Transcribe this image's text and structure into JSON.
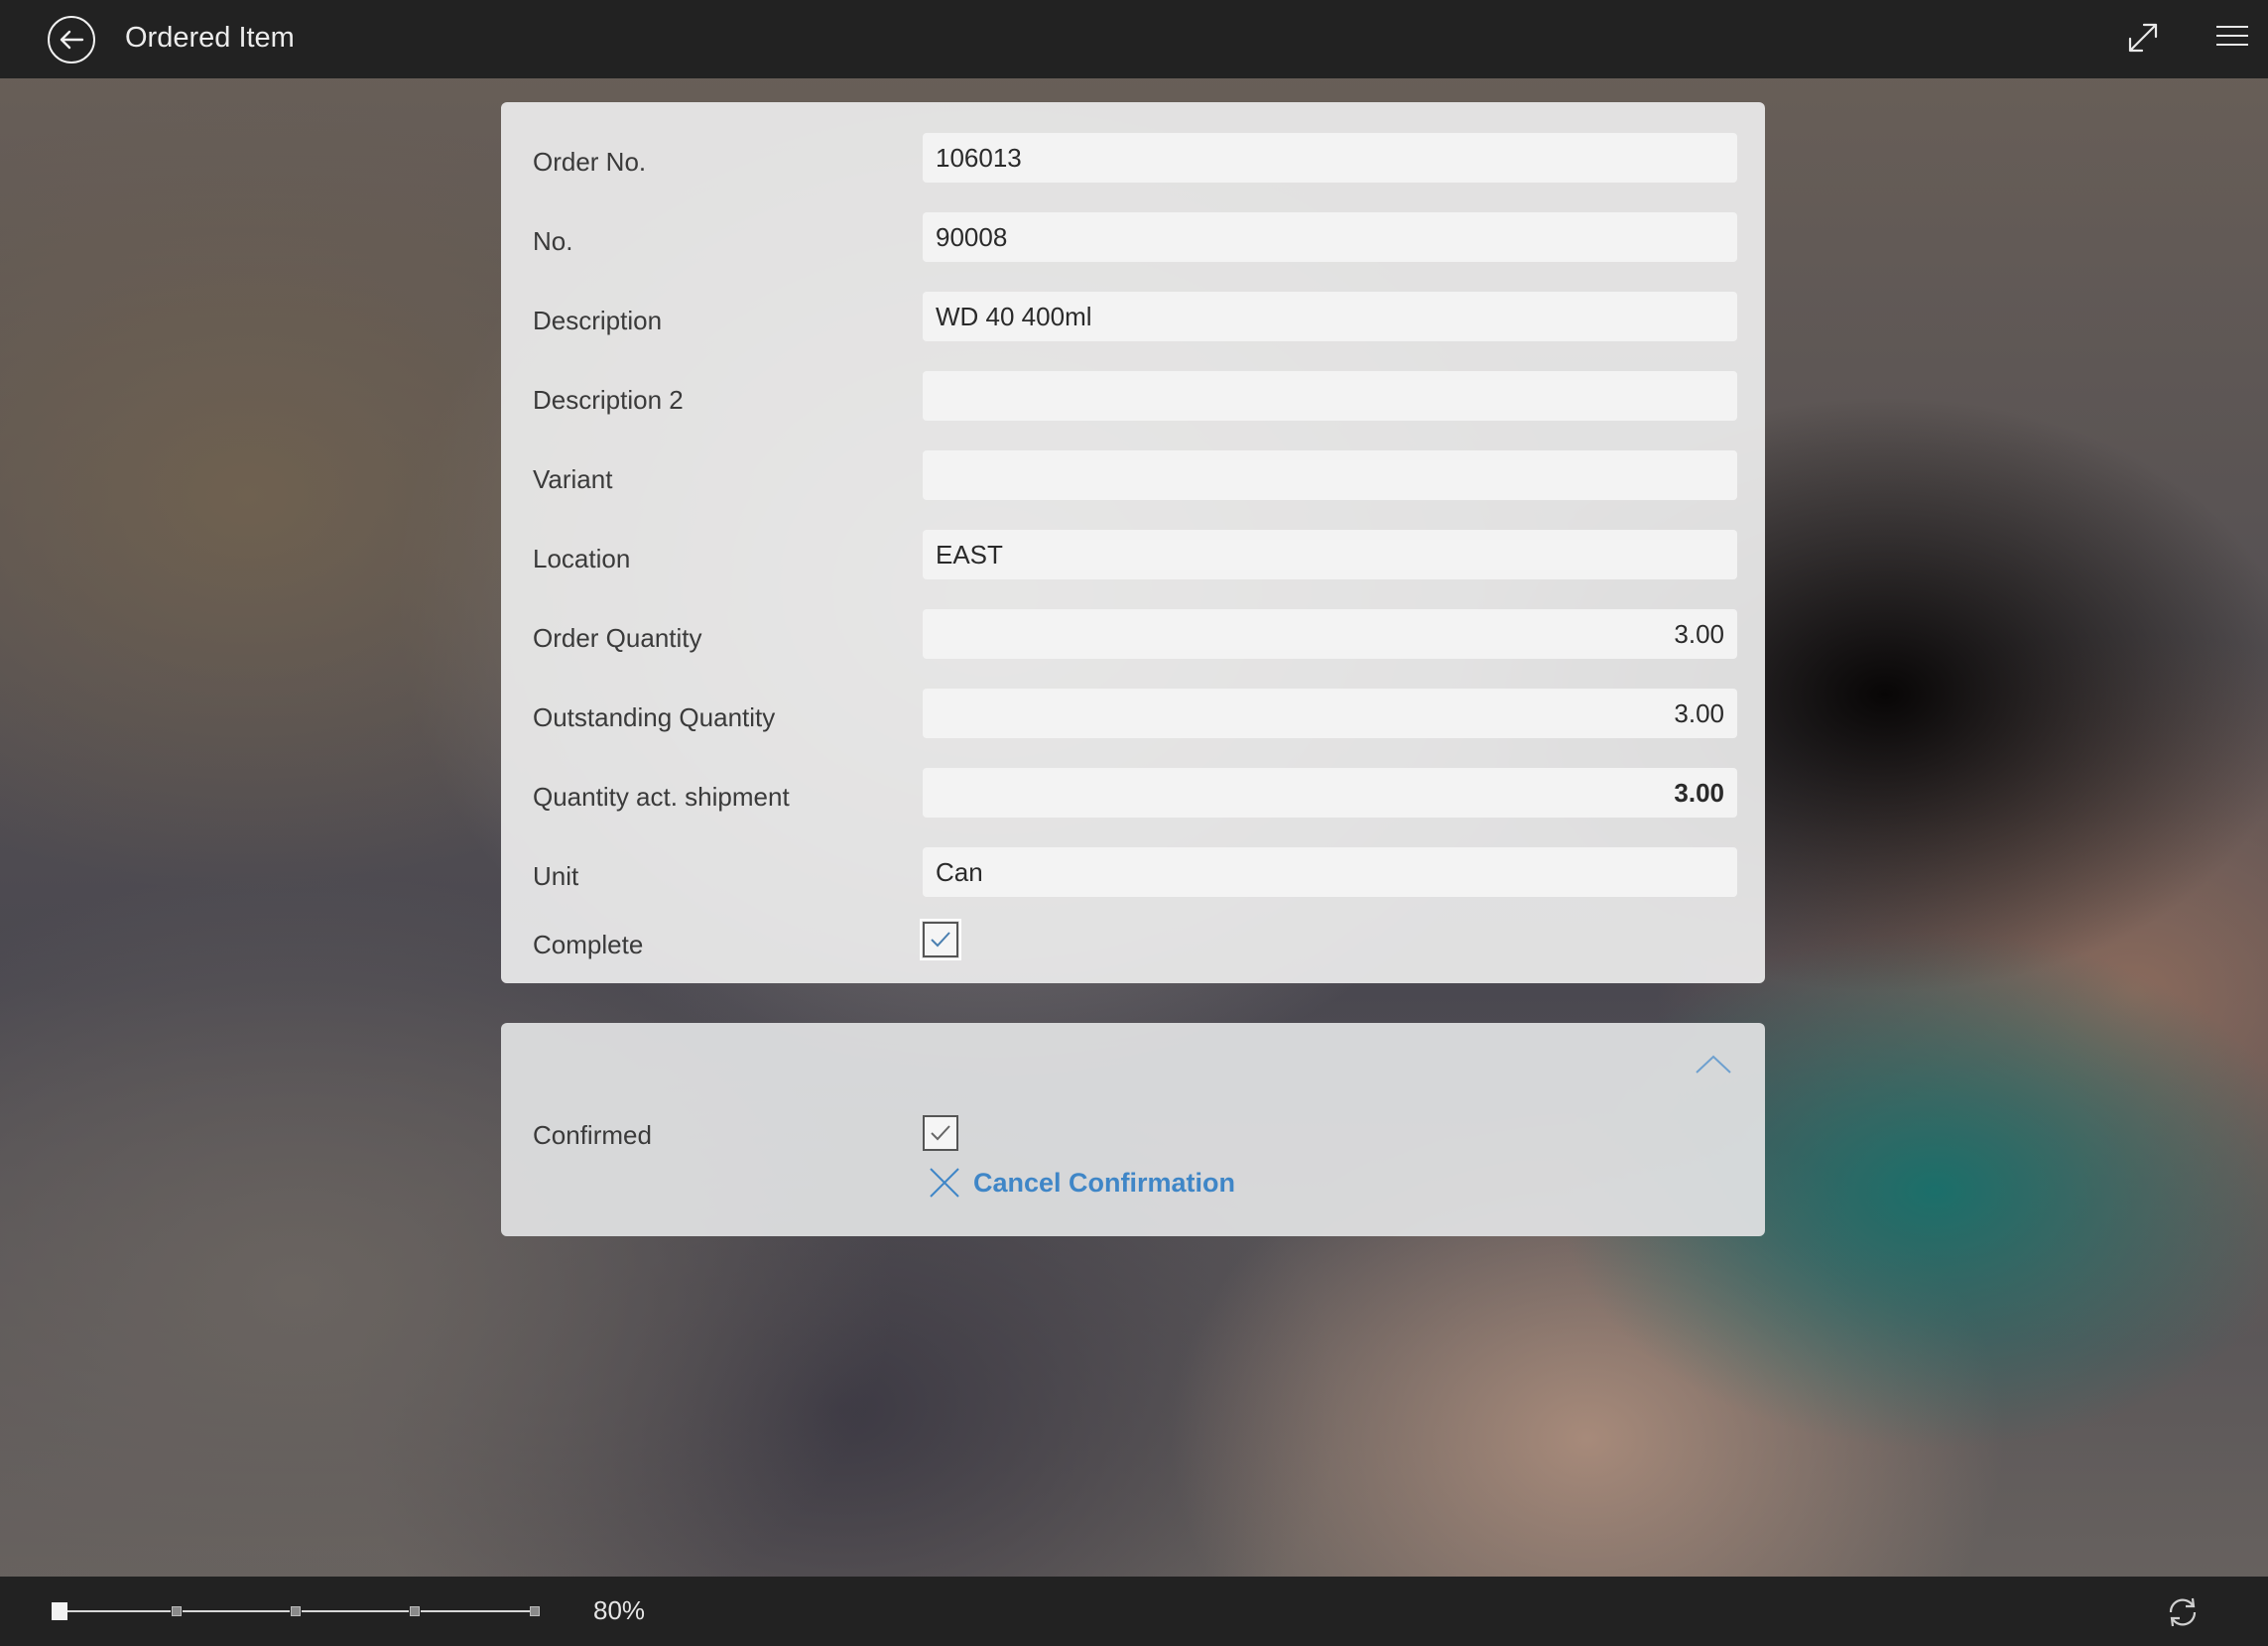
{
  "header": {
    "title": "Ordered Item"
  },
  "form": {
    "order_no": {
      "label": "Order No.",
      "value": "106013"
    },
    "no": {
      "label": "No.",
      "value": "90008"
    },
    "description": {
      "label": "Description",
      "value": "WD 40 400ml"
    },
    "description2": {
      "label": "Description 2",
      "value": ""
    },
    "variant": {
      "label": "Variant",
      "value": ""
    },
    "location": {
      "label": "Location",
      "value": "EAST"
    },
    "order_quantity": {
      "label": "Order Quantity",
      "value": "3.00"
    },
    "outstanding_quantity": {
      "label": "Outstanding Quantity",
      "value": "3.00"
    },
    "qty_act_shipment": {
      "label": "Quantity act. shipment",
      "value": "3.00"
    },
    "unit": {
      "label": "Unit",
      "value": "Can"
    },
    "complete": {
      "label": "Complete",
      "checked": true
    }
  },
  "confirmation": {
    "confirmed": {
      "label": "Confirmed",
      "checked": true
    },
    "cancel_label": "Cancel Confirmation"
  },
  "footer": {
    "zoom_label": "80%",
    "zoom_level": 0.8
  },
  "colors": {
    "bar": "#222222",
    "link": "#3f86c7",
    "card": "#ececec"
  },
  "icons": {
    "back": "back-arrow-icon",
    "expand": "expand-icon",
    "menu": "hamburger-menu-icon",
    "collapse": "chevron-up-icon",
    "cancel": "close-icon",
    "sync": "sync-icon"
  }
}
